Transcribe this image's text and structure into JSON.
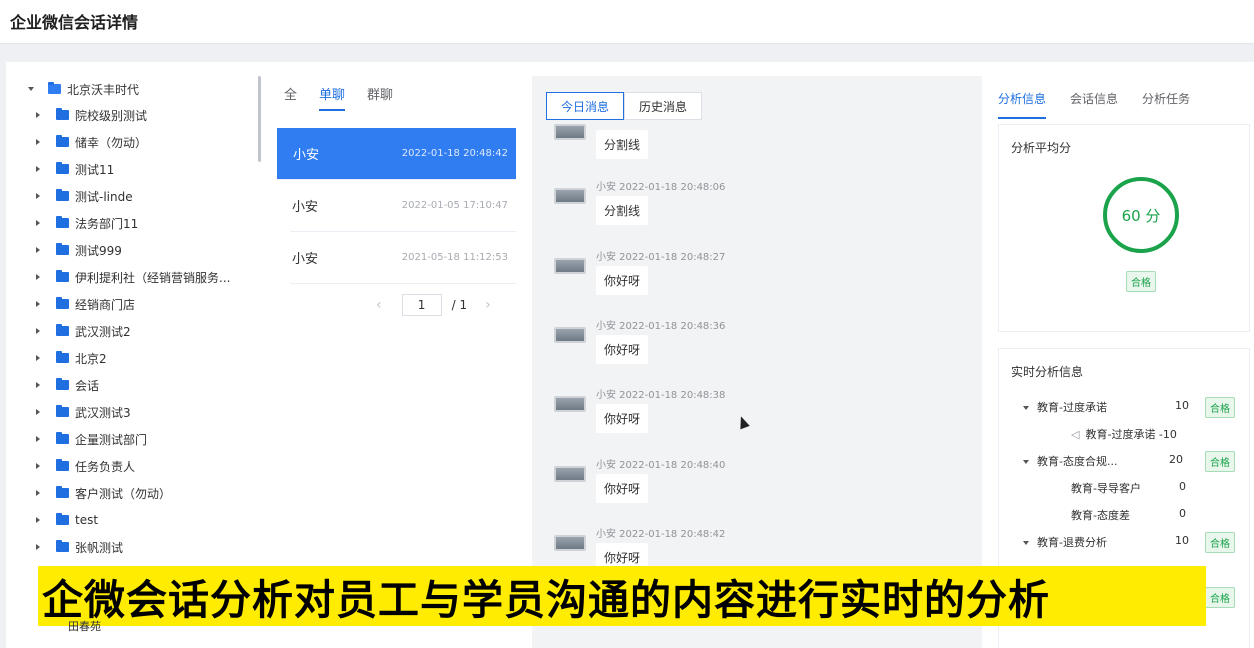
{
  "header": {
    "title": "企业微信会话详情"
  },
  "tree": {
    "root": "北京沃丰时代",
    "items": [
      "院校级别测试",
      "储幸（勿动）",
      "测试11",
      "测试-linde",
      "法务部门11",
      "测试999",
      "伊利提利社（经销营销服务...",
      "经销商门店",
      "武汉测试2",
      "北京2",
      "会话",
      "武汉测试3",
      "企量测试部门",
      "任务负责人",
      "客户测试（勿动）",
      "test",
      "张帆测试"
    ],
    "below": "田春苑"
  },
  "sessions": {
    "tabs": [
      "全",
      "单聊",
      "群聊"
    ],
    "list": [
      {
        "name": "小安",
        "time": "2022-01-18 20:48:42"
      },
      {
        "name": "小安",
        "time": "2022-01-05 17:10:47"
      },
      {
        "name": "小安",
        "time": "2021-05-18 11:12:53"
      }
    ],
    "pager": {
      "page": "1",
      "total": "/ 1"
    }
  },
  "chat": {
    "tabs": [
      "今日消息",
      "历史消息"
    ],
    "messages": [
      {
        "meta": "",
        "text": "分割线"
      },
      {
        "meta": "小安  2022-01-18 20:48:06",
        "text": "分割线"
      },
      {
        "meta": "小安  2022-01-18 20:48:27",
        "text": "你好呀"
      },
      {
        "meta": "小安  2022-01-18 20:48:36",
        "text": "你好呀"
      },
      {
        "meta": "小安  2022-01-18 20:48:38",
        "text": "你好呀"
      },
      {
        "meta": "小安  2022-01-18 20:48:40",
        "text": "你好呀"
      },
      {
        "meta": "小安  2022-01-18 20:48:42",
        "text": "你好呀"
      }
    ]
  },
  "analysis": {
    "tabs": [
      "分析信息",
      "会话信息",
      "分析任务"
    ],
    "avg_title": "分析平均分",
    "score": "60 分",
    "score_tag": "合格",
    "realtime_title": "实时分析信息",
    "rows": [
      {
        "label": "教育-过度承诺",
        "value": "10",
        "tag": "合格"
      },
      {
        "label": "教育-过度承诺 -10",
        "value": "",
        "tag": ""
      },
      {
        "label": "教育-态度合规...",
        "value": "20",
        "tag": "合格"
      },
      {
        "label": "教育-导导客户",
        "value": "0",
        "tag": ""
      },
      {
        "label": "教育-态度差",
        "value": "0",
        "tag": ""
      },
      {
        "label": "教育-退费分析",
        "value": "10",
        "tag": "合格"
      }
    ],
    "extra_tag": "合格",
    "accent": "#1aa34a"
  },
  "caption": {
    "text": "企微会话分析对员工与学员沟通的内容进行实时的分析"
  }
}
